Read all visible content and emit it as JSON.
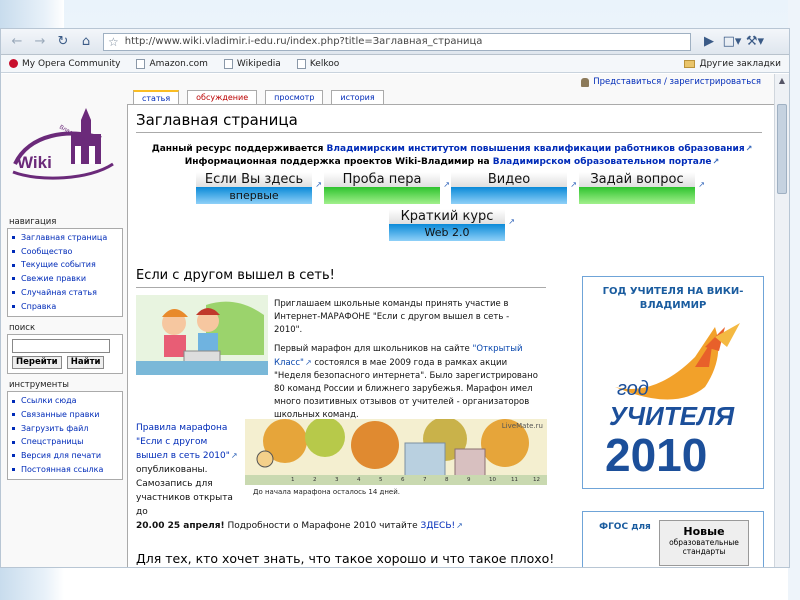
{
  "browser": {
    "address_url": "http://www.wiki.vladimir.i-edu.ru/index.php?title=Заглавная_страница",
    "bookmarks": [
      "My Opera Community",
      "Amazon.com",
      "Wikipedia",
      "Kelkoo"
    ],
    "other_bookmarks": "Другие закладки"
  },
  "wiki": {
    "logo_text": "Wiki",
    "logo_sub": "Владимир",
    "personal_link": "Представиться / зарегистрироваться",
    "tabs": [
      "статья",
      "обсуждение",
      "просмотр",
      "история"
    ],
    "page_title": "Заглавная страница",
    "notice1_prefix": "Данный ресурс поддерживается ",
    "notice1_link": "Владимирским институтом повышения квалификации работников образования",
    "notice2_prefix": "Информационная поддержка проектов Wiki-Владимир на ",
    "notice2_link": "Владимирском образовательном портале",
    "banners": [
      {
        "top": "Если Вы здесь",
        "bottom": "впервые"
      },
      {
        "top": "Проба пера",
        "bottom": ""
      },
      {
        "top": "Видео",
        "bottom": ""
      },
      {
        "top": "Задай вопрос",
        "bottom": ""
      },
      {
        "top": "Краткий курс",
        "bottom": "Web 2.0"
      }
    ],
    "section_title": "Если с другом вышел в сеть!",
    "para1": "Приглашаем школьные команды принять участие в Интернет-МАРАФОНЕ \"Если с другом вышел в сеть - 2010\".",
    "para2_prefix": "Первый марафон для школьников на сайте ",
    "para2_link": "\"Открытый Класс\"",
    "para2_rest": " состоялся в мае 2009 года в рамках акции \"Неделя безопасного интернета\". Было зарегистрировано 80 команд России и ближнего зарубежья. Марафон имел много позитивных отзывов от учителей - организаторов школьных команд.",
    "rules_link": "Правила марафона \"Если с другом вышел в сеть 2010\"",
    "rules_rest": "опубликованы. Самозапись для участников открыта до",
    "deadline": "20.00 25 апреля!",
    "details_prefix": " Подробности о Марафоне 2010 читайте ",
    "details_link": "ЗДЕСЬ!",
    "countdown_caption": "До начала марафона осталось 14 дней.",
    "countdown_watermark": "LiveMate.ru",
    "countdown_numbers": [
      "1",
      "2",
      "3",
      "4",
      "5",
      "6",
      "7",
      "8",
      "9",
      "10",
      "11",
      "12"
    ],
    "next_heading": "Для тех, кто хочет знать, что такое хорошо и что такое плохо!",
    "year_box_title": "ГОД УЧИТЕЛЯ НА ВИКИ-ВЛАДИМИР",
    "year_logo_word1": "год",
    "year_logo_word2": "УЧИТЕЛЯ",
    "year_logo_year": "2010",
    "fgos_title": "ФГОС для",
    "fgos_badge_1": "Новые",
    "fgos_badge_2": "образовательные стандарты"
  },
  "sidebar": {
    "nav_title": "навигация",
    "nav_items": [
      "Заглавная страница",
      "Сообщество",
      "Текущие события",
      "Свежие правки",
      "Случайная статья",
      "Справка"
    ],
    "search_title": "поиск",
    "search_go": "Перейти",
    "search_find": "Найти",
    "tools_title": "инструменты",
    "tools_items": [
      "Ссылки сюда",
      "Связанные правки",
      "Загрузить файл",
      "Спецстраницы",
      "Версия для печати",
      "Постоянная ссылка"
    ]
  },
  "colors": {
    "link": "#002bb8",
    "accent_blue": "#1a5c9f",
    "logo_purple": "#6b2a7a"
  }
}
